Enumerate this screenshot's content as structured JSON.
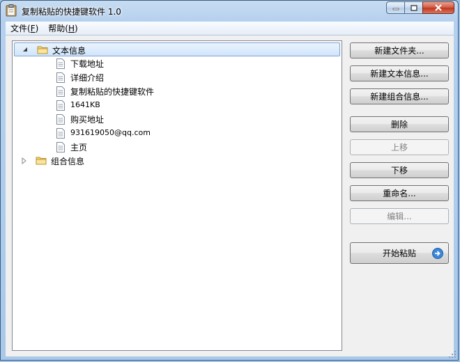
{
  "window": {
    "title": "复制粘贴的快捷键软件 1.0"
  },
  "menu": [
    {
      "label": "文件(",
      "key": "F",
      "end": ")"
    },
    {
      "label": "帮助(",
      "key": "H",
      "end": ")"
    }
  ],
  "tree": {
    "root1": {
      "label": "文本信息",
      "expanded": true,
      "children": [
        "下载地址",
        "详细介绍",
        "复制粘贴的快捷键软件",
        "1641KB",
        "购买地址",
        "931619050@qq.com",
        "主页"
      ]
    },
    "root2": {
      "label": "组合信息",
      "expanded": false
    }
  },
  "buttons": {
    "new_folder": "新建文件夹...",
    "new_text": "新建文本信息...",
    "new_group": "新建组合信息...",
    "delete": "删除",
    "move_up": "上移",
    "move_down": "下移",
    "rename": "重命名...",
    "edit": "编辑...",
    "start_paste": "开始粘贴"
  },
  "colors": {
    "accent": "#3c86d8",
    "selection": "#d0e5fb",
    "titlebar": "#b5d0ee"
  }
}
